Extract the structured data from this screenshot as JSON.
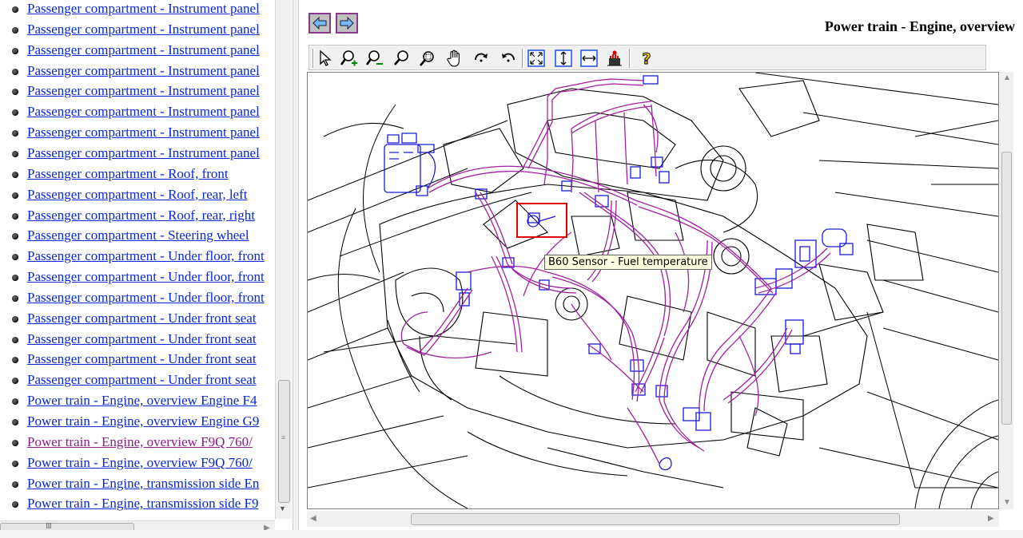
{
  "left_list": {
    "items": [
      {
        "label": "Passenger compartment - Instrument panel",
        "visited": false
      },
      {
        "label": "Passenger compartment - Instrument panel",
        "visited": false
      },
      {
        "label": "Passenger compartment - Instrument panel",
        "visited": false
      },
      {
        "label": "Passenger compartment - Instrument panel",
        "visited": false
      },
      {
        "label": "Passenger compartment - Instrument panel",
        "visited": false
      },
      {
        "label": "Passenger compartment - Instrument panel",
        "visited": false
      },
      {
        "label": "Passenger compartment - Instrument panel",
        "visited": false
      },
      {
        "label": "Passenger compartment - Instrument panel",
        "visited": false
      },
      {
        "label": "Passenger compartment - Roof, front",
        "visited": false
      },
      {
        "label": "Passenger compartment - Roof, rear, left",
        "visited": false
      },
      {
        "label": "Passenger compartment - Roof, rear, right",
        "visited": false
      },
      {
        "label": "Passenger compartment - Steering wheel",
        "visited": false
      },
      {
        "label": "Passenger compartment - Under floor, front",
        "visited": false
      },
      {
        "label": "Passenger compartment - Under floor, front",
        "visited": false
      },
      {
        "label": "Passenger compartment - Under floor, front",
        "visited": false
      },
      {
        "label": "Passenger compartment - Under front seat",
        "visited": false
      },
      {
        "label": "Passenger compartment - Under front seat",
        "visited": false
      },
      {
        "label": "Passenger compartment - Under front seat",
        "visited": false
      },
      {
        "label": "Passenger compartment - Under front seat",
        "visited": false
      },
      {
        "label": "Power train - Engine, overview Engine F4",
        "visited": false
      },
      {
        "label": "Power train - Engine, overview Engine G9",
        "visited": false
      },
      {
        "label": "Power train - Engine, overview F9Q 760/",
        "visited": true
      },
      {
        "label": "Power train - Engine, overview F9Q 760/",
        "visited": false
      },
      {
        "label": "Power train - Engine, transmission side En",
        "visited": false
      },
      {
        "label": "Power train - Engine, transmission side F9",
        "visited": false
      }
    ]
  },
  "document": {
    "title": "Power train - Engine, overview"
  },
  "navigation": {
    "back_icon": "arrow-left-icon",
    "forward_icon": "arrow-right-icon"
  },
  "toolbar": {
    "tools": [
      {
        "name": "select-pointer-icon"
      },
      {
        "name": "zoom-in-icon"
      },
      {
        "name": "zoom-out-icon"
      },
      {
        "name": "zoom-icon"
      },
      {
        "name": "zoom-area-icon"
      },
      {
        "name": "pan-hand-icon"
      },
      {
        "name": "rotate-clockwise-icon"
      },
      {
        "name": "rotate-counterclockwise-icon"
      },
      {
        "name": "fit-all-icon"
      },
      {
        "name": "fit-height-icon"
      },
      {
        "name": "fit-width-icon"
      },
      {
        "name": "highlight-icon"
      },
      {
        "name": "help-icon"
      }
    ]
  },
  "diagram": {
    "tooltip": "B60 Sensor - Fuel temperature"
  },
  "colors": {
    "link": "#0a27d6",
    "visited_link": "#8e1a8e",
    "wiring": "#a020a0",
    "connector": "#1a1ad8",
    "highlight": "#e00000",
    "tooltip_bg": "#ffffe1"
  }
}
